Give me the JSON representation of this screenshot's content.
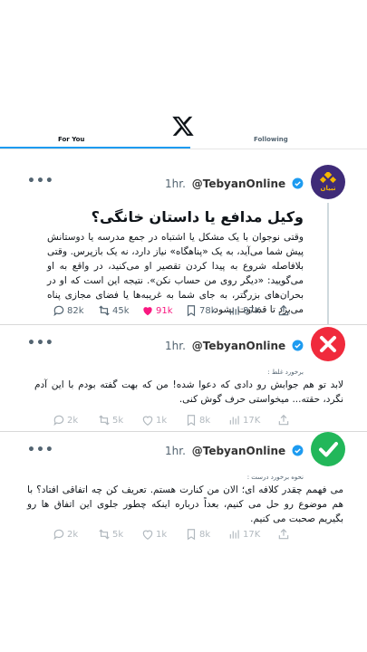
{
  "header": {
    "tab_for_you": "For You",
    "tab_following": "Following"
  },
  "tweets": [
    {
      "time": "1hr.",
      "handle": "@TebyanOnline",
      "avatar_brand": "تبیان",
      "title": "وکیل مدافع یا داستان خانگی؟",
      "body": "وقتی نوجوان با یک مشکل یا اشتباه در جمع مدرسه یا دوستانش پیش شما می‌آید، به یک «پناهگاه» نیاز دارد، نه یک بازپرس. وقتی بلافاصله شروع به پیدا کردن تقصیر او می‌کنید، در واقع به او می‌گویید: «دیگر روی من حساب نکن». نتیجه این است که او در بحران‌های بزرگتر، به جای شما به غریبه‌ها یا فضای مجازی پناه می‌برد تا قضاوت نشود.",
      "stats": {
        "replies": "82k",
        "reposts": "45k",
        "likes": "91k",
        "bookmarks": "78k",
        "views": "87K"
      }
    },
    {
      "time": "1hr.",
      "handle": "@TebyanOnline",
      "label": "برخورد غلط :",
      "body": "لابد تو هم جوابش رو دادی که دعوا شده! من که بهت گفته بودم با این آدم نگرد، حقته... میخواستی حرف گوش کنی.",
      "stats": {
        "replies": "2k",
        "reposts": "5k",
        "likes": "1k",
        "bookmarks": "8k",
        "views": "17K"
      }
    },
    {
      "time": "1hr.",
      "handle": "@TebyanOnline",
      "label": "نحوه برخورد درست :",
      "body": "می فهمم چقدر کلافه ای؛ الان من کنارت هستم. تعریف کن چه اتفاقی افتاد؟ با هم موضوع رو حل می کنیم، بعداً درباره اینکه چطور جلوی این اتفاق ها رو بگیریم صحبت می کنیم.",
      "stats": {
        "replies": "2k",
        "reposts": "5k",
        "likes": "1k",
        "bookmarks": "8k",
        "views": "17K"
      }
    }
  ],
  "icons": [
    "x-logo-icon",
    "verified-badge-icon",
    "more-icon",
    "reply-icon",
    "repost-icon",
    "heart-icon",
    "bookmark-icon",
    "views-icon",
    "share-icon",
    "cross-icon",
    "check-icon"
  ],
  "colors": {
    "accent": "#1d9bf0",
    "like": "#f91880",
    "wrong": "#f02a3c",
    "right": "#22b75a",
    "brand_bg": "#3f2b78",
    "brand_gold": "#f5b800"
  }
}
